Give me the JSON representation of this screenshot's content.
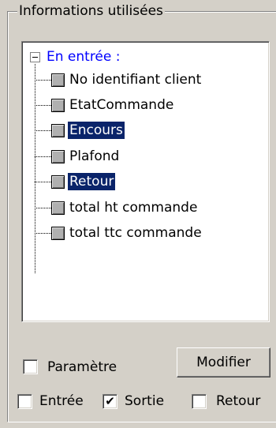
{
  "group": {
    "title": "Informations utilisées"
  },
  "tree": {
    "root": {
      "label": "En entrée :",
      "expander_icon": "minus-box-icon"
    },
    "items": [
      {
        "label": "No identifiant client",
        "selected": false
      },
      {
        "label": "EtatCommande",
        "selected": false
      },
      {
        "label": "Encours",
        "selected": true
      },
      {
        "label": "Plafond",
        "selected": false
      },
      {
        "label": "Retour",
        "selected": true
      },
      {
        "label": "total ht commande",
        "selected": false
      },
      {
        "label": "total ttc commande",
        "selected": false
      }
    ]
  },
  "options": {
    "parametre": {
      "label": "Paramètre",
      "checked": false
    },
    "modifier_button": "Modifier",
    "entree": {
      "label": "Entrée",
      "checked": false
    },
    "sortie": {
      "label": "Sortie",
      "checked": true
    },
    "retour": {
      "label": "Retour",
      "checked": false
    }
  },
  "colors": {
    "background": "#d4d0c8",
    "selection": "#0a246a",
    "root_text": "#0000ff"
  }
}
